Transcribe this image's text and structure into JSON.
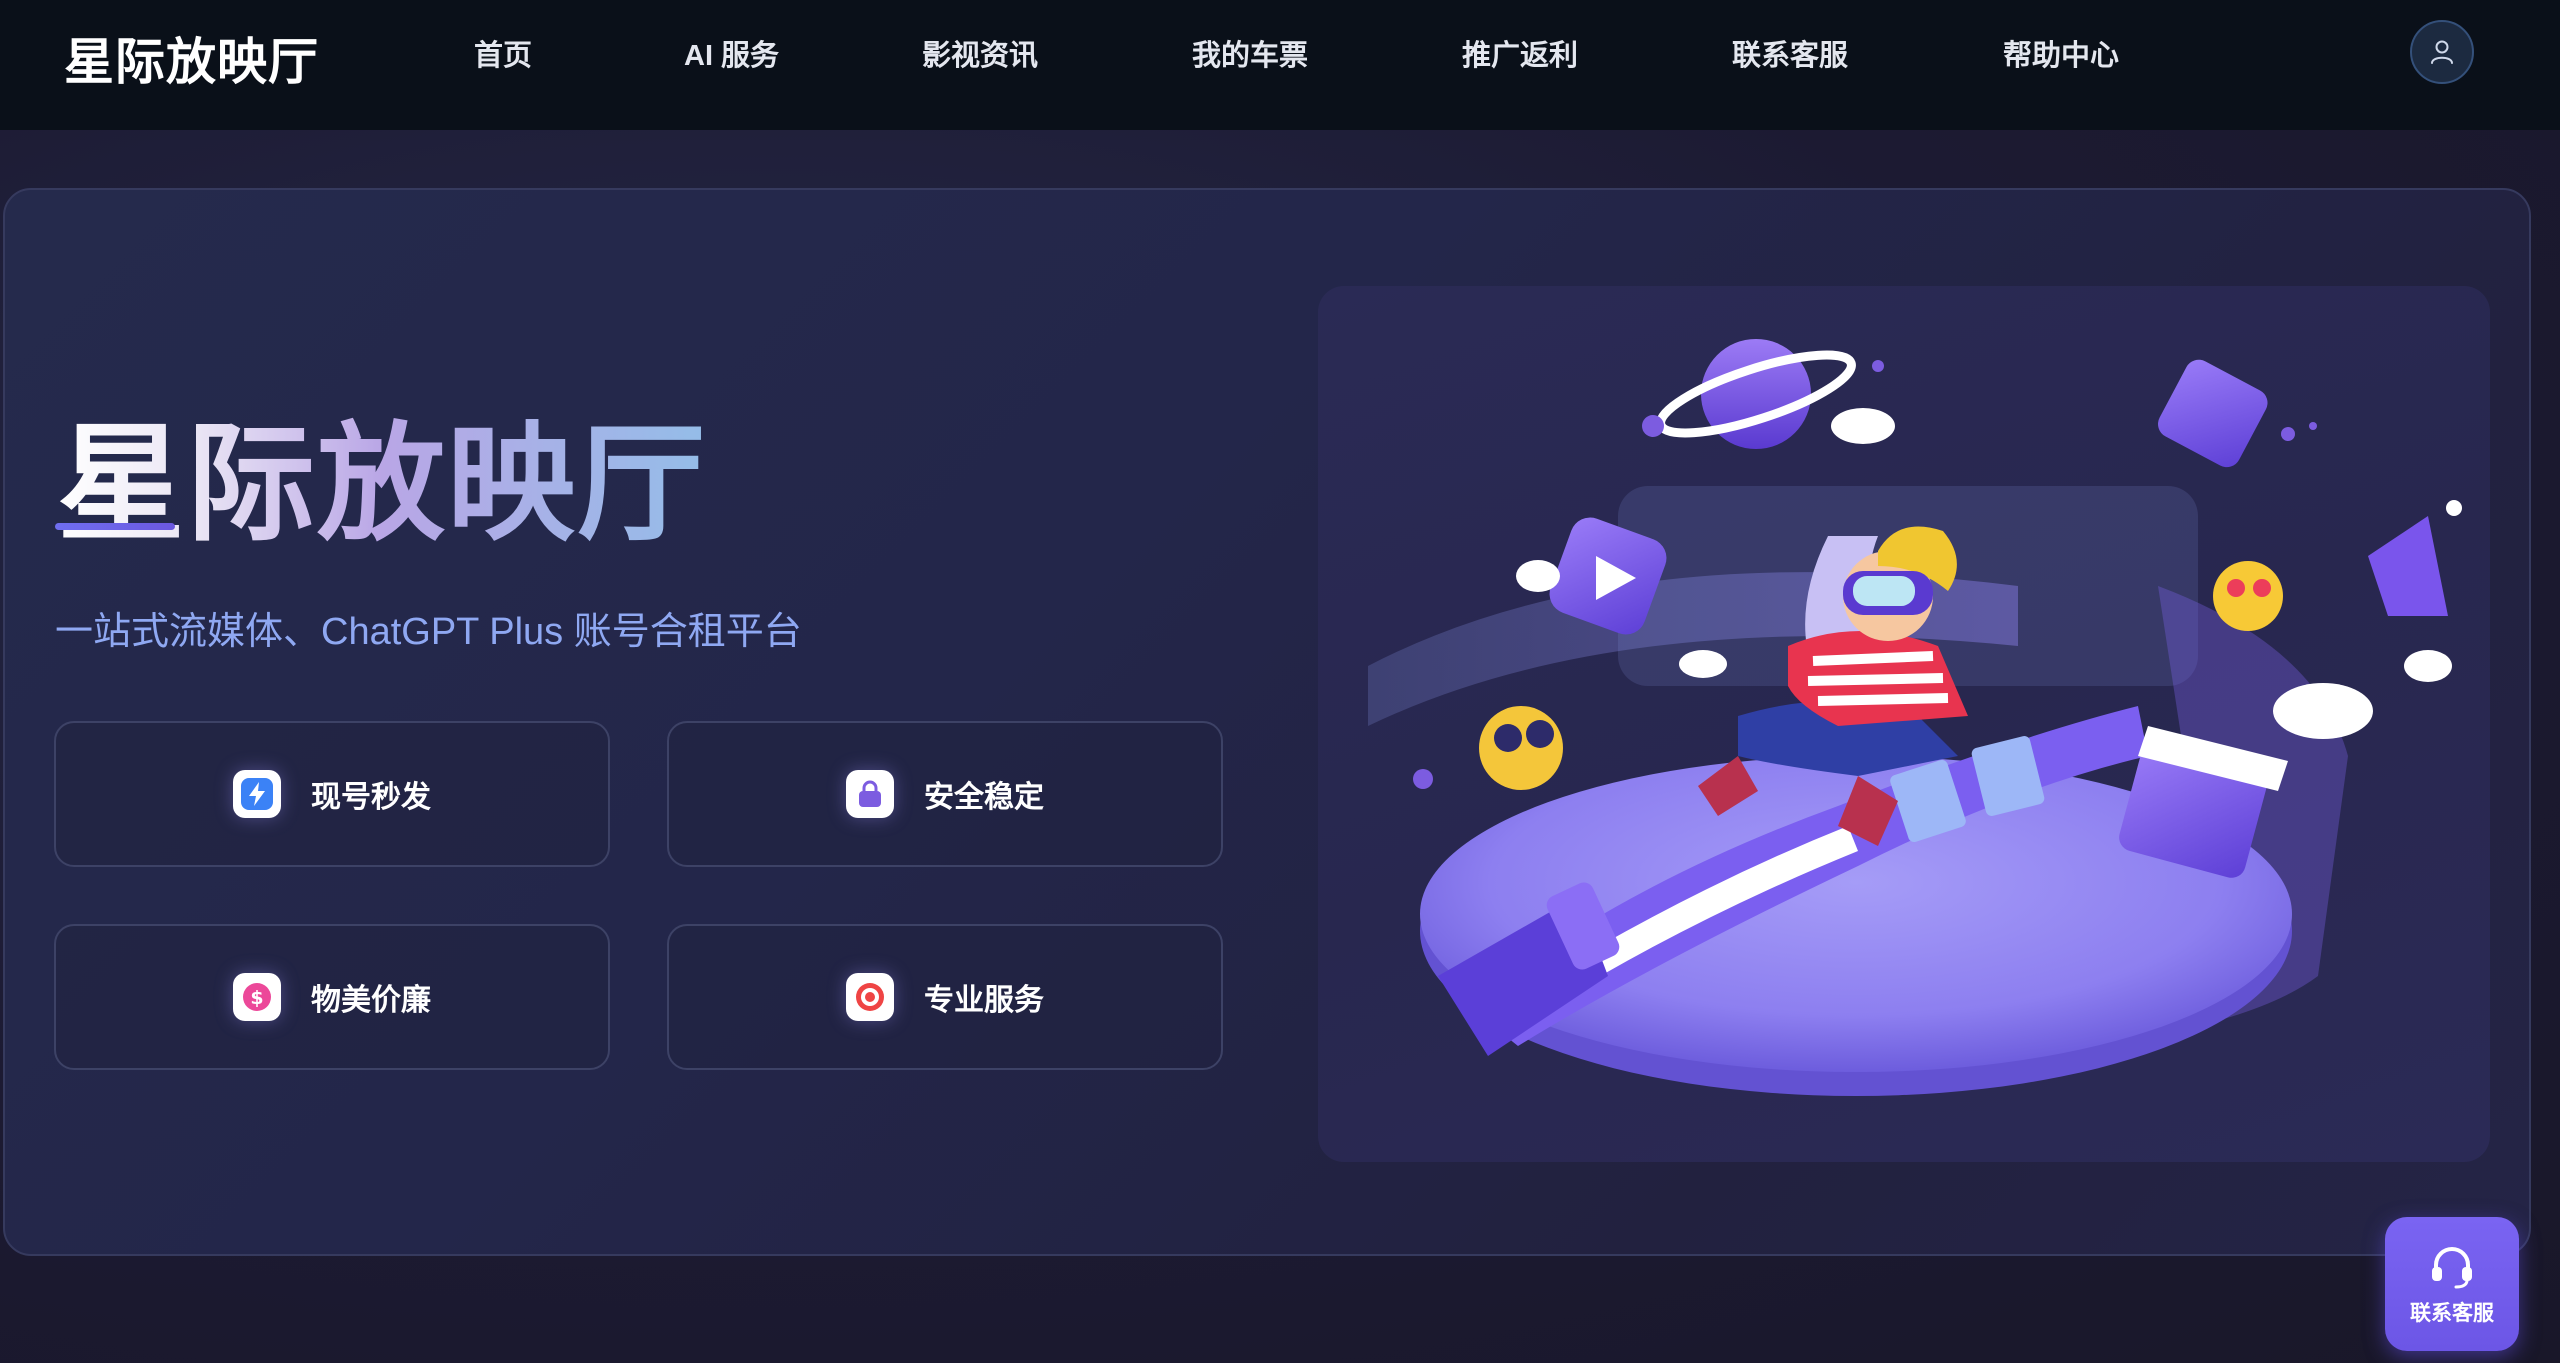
{
  "header": {
    "logo": "星际放映厅",
    "nav": [
      "首页",
      "AI 服务",
      "影视资讯",
      "我的车票",
      "推广返利",
      "联系客服",
      "帮助中心"
    ]
  },
  "hero": {
    "title": "星际放映厅",
    "subtitle": "一站式流媒体、ChatGPT Plus 账号合租平台",
    "features": [
      {
        "label": "现号秒发",
        "icon": "lightning-icon"
      },
      {
        "label": "安全稳定",
        "icon": "lock-icon"
      },
      {
        "label": "物美价廉",
        "icon": "dollar-icon"
      },
      {
        "label": "专业服务",
        "icon": "target-icon"
      }
    ]
  },
  "float_button": {
    "label": "联系客服",
    "icon": "headset-icon"
  },
  "colors": {
    "header_bg": "#0a1019",
    "page_bg": "#1c1a32",
    "accent": "#7a64f2",
    "subtitle": "#8fa8f2"
  }
}
